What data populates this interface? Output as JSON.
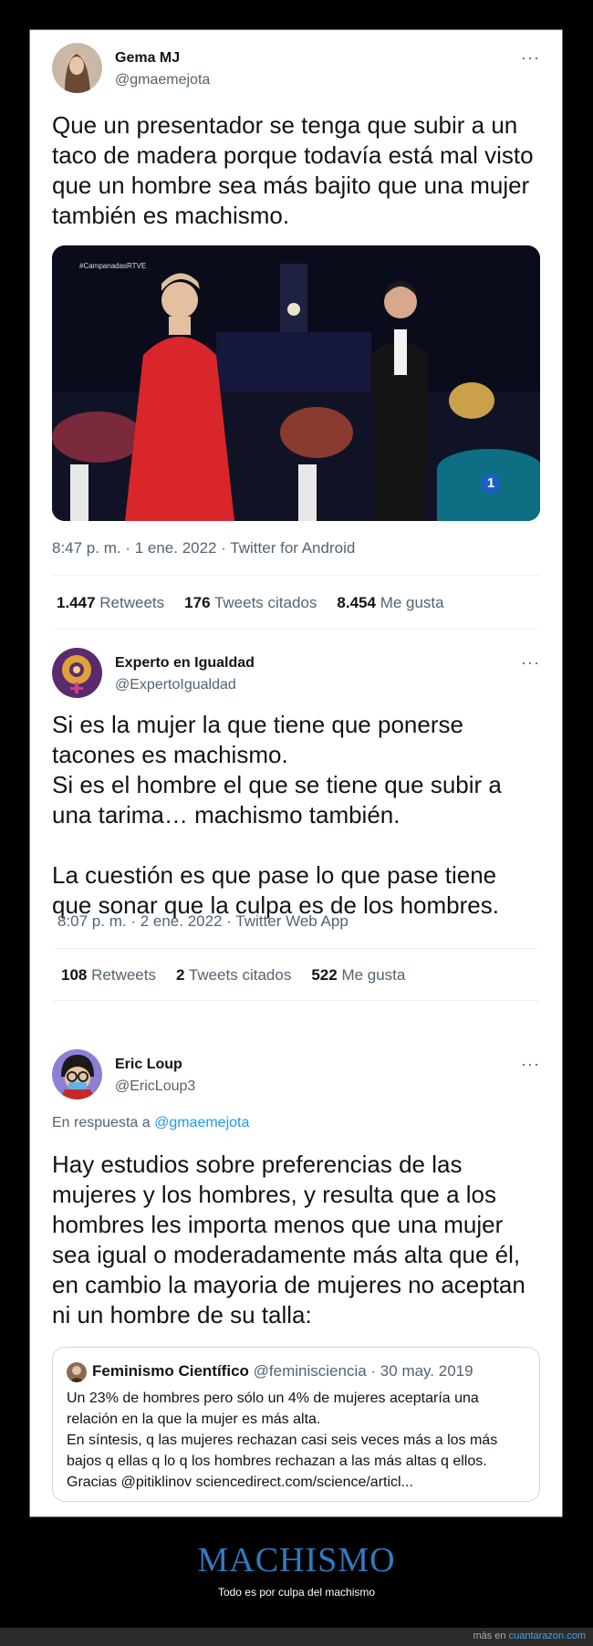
{
  "tweets": [
    {
      "name": "Gema MJ",
      "handle": "@gmaemejota",
      "more": "···",
      "text": "Que un presentador se tenga que subir a un taco de madera porque todavía está mal visto que un hombre sea más bajito que una mujer también es machismo.",
      "media_caption": "#CampanadasRTVE",
      "channel_badge": "1",
      "meta": "8:47 p. m. · 1 ene. 2022 · Twitter for Android",
      "stats": [
        {
          "count": "1.447",
          "label": "Retweets"
        },
        {
          "count": "176",
          "label": "Tweets citados"
        },
        {
          "count": "8.454",
          "label": "Me gusta"
        }
      ]
    },
    {
      "name": "Experto en Igualdad",
      "handle": "@ExpertoIgualdad",
      "more": "···",
      "text": "Si es la mujer la que tiene que ponerse tacones es machismo.\nSi es el hombre el que se tiene que subir a una tarima… machismo también.\n\nLa cuestión es que pase lo que pase tiene que sonar que la culpa es de los hombres.",
      "meta": "8:07 p. m. · 2 ene. 2022 · Twitter Web App",
      "stats": [
        {
          "count": "108",
          "label": "Retweets"
        },
        {
          "count": "2",
          "label": "Tweets citados"
        },
        {
          "count": "522",
          "label": "Me gusta"
        }
      ]
    },
    {
      "name": "Eric Loup",
      "handle": "@EricLoup3",
      "more": "···",
      "reply_prefix": "En respuesta a",
      "reply_mention": "@gmaemejota",
      "text": "Hay estudios sobre preferencias de las mujeres y los hombres, y resulta que a los hombres les importa menos que una mujer sea igual o moderadamente más alta que él, en cambio la mayoria de mujeres no aceptan ni un hombre de su talla:",
      "quote": {
        "name": "Feminismo Científico",
        "handle": "@feminisciencia",
        "date": "· 30 may. 2019",
        "text": "Un 23% de hombres pero sólo un 4% de mujeres aceptaría una relación en la que la mujer es más alta.\nEn síntesis, q las mujeres rechazan casi seis veces más a los más bajos q ellas q lo q los hombres rechazan a las más altas q ellos.\nGracias @pitiklinov sciencedirect.com/science/articl..."
      }
    }
  ],
  "footer": {
    "title": "MACHISMO",
    "subtitle": "Todo es por culpa del machismo",
    "credit_prefix": "más en",
    "credit_site": "cuantarazon.com"
  }
}
